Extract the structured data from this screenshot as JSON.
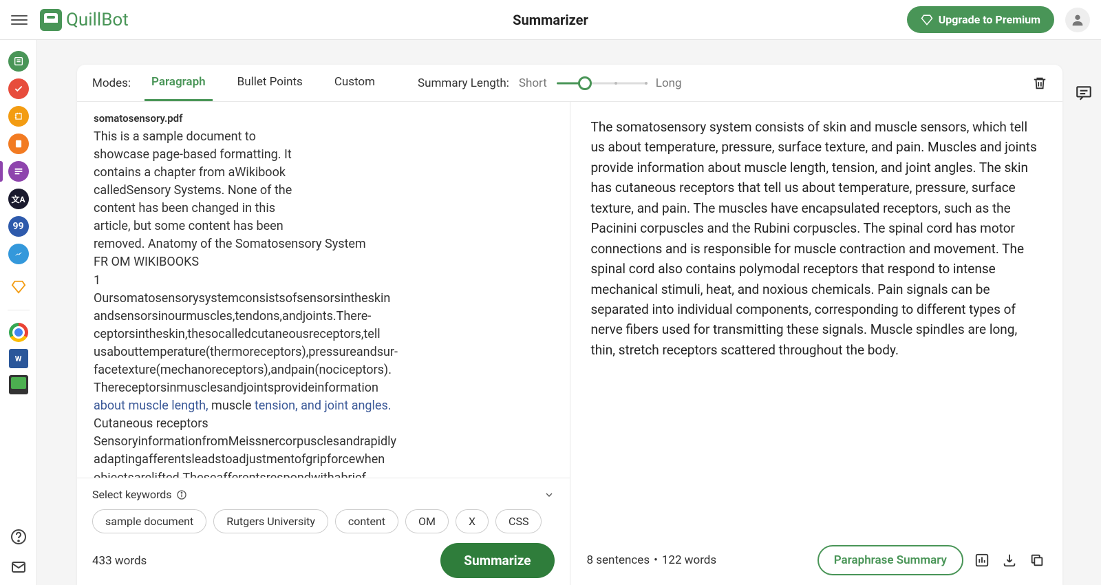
{
  "header": {
    "title": "Summarizer",
    "logo_text": "QuillBot",
    "upgrade_label": "Upgrade to Premium"
  },
  "modes": {
    "label": "Modes:",
    "tabs": [
      "Paragraph",
      "Bullet Points",
      "Custom"
    ],
    "active_index": 0
  },
  "length": {
    "label": "Summary Length:",
    "short": "Short",
    "long": "Long",
    "position_pct": 32
  },
  "input": {
    "filename": "somatosensory.pdf",
    "body_pre": "This is a sample document to\nshowcase page-based formatting. It\ncontains a chapter from aWikibook\ncalledSensory Systems. None of the\ncontent has been changed in this\narticle, but some content has been\nremoved. Anatomy of the Somatosensory System\nFR OM WIKIBOOKS\n1\nOursomatosensorysystemconsistsofsensorsintheskin\nandsensorsinourmuscles,tendons,andjoints.There-\nceptorsintheskin,thesocalledcutaneousreceptors,tell\nusabouttemperature(thermoreceptors),pressureandsur-\nfacetexture(mechanoreceptors),andpain(nociceptors).\nThereceptorsinmusclesandjointsprovideinformation",
    "link1": "about muscle length,",
    "mid": " muscle ",
    "link2": "tension, and joint angles.",
    "body_post": "\nCutaneous receptors\nSensoryinformationfromMeissnercorpusclesandrapidly\nadaptingafferentsleadstoadjustmentofgripforcewhen\nobjectsarelifted.Theseafferentsrespondwithabrief\nburstofactionpotentialswhenobjectsmoveasmalldis",
    "word_count": "433 words"
  },
  "keywords": {
    "label": "Select keywords",
    "chips": [
      "sample document",
      "Rutgers University",
      "content",
      "OM",
      "X",
      "CSS"
    ]
  },
  "actions": {
    "summarize": "Summarize",
    "paraphrase": "Paraphrase Summary"
  },
  "output": {
    "text": "The somatosensory system consists of skin and muscle sensors, which tell us about temperature, pressure, surface texture, and pain. Muscles and joints provide information about muscle length, tension, and joint angles. The skin has cutaneous receptors that tell us about temperature, pressure, surface texture, and pain. The muscles have encapsulated receptors, such as the Pacinini corpuscles and the Rubini corpuscles. The spinal cord has motor connections and is responsible for muscle contraction and movement. The spinal cord also contains polymodal receptors that respond to intense mechanical stimuli, heat, and noxious chemicals. Pain signals can be separated into individual components, corresponding to different types of nerve fibers used for transmitting these signals. Muscle spindles are long, thin, stretch receptors scattered throughout the body.",
    "sentences": "8 sentences",
    "words": "122 words"
  },
  "colors": {
    "brand_green": "#499557",
    "accent_dark_green": "#2f7d3b"
  }
}
